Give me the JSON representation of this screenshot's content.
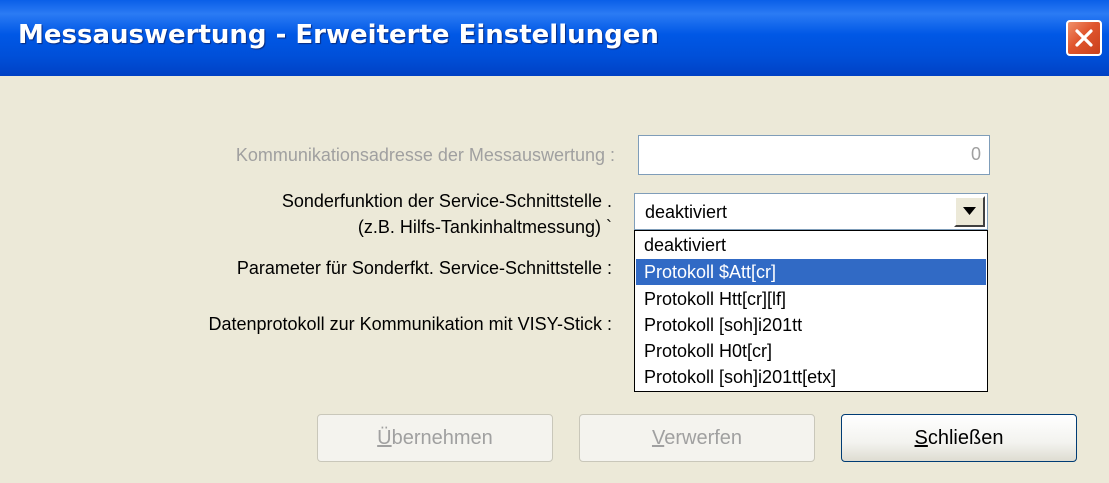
{
  "window": {
    "title": "Messauswertung - Erweiterte Einstellungen",
    "close_label": "×"
  },
  "form": {
    "address_label": "Kommunikationsadresse der Messauswertung :",
    "address_value": "0",
    "special_function_label_line1": "Sonderfunktion der Service-Schnittstelle .",
    "special_function_label_line2": "(z.B. Hilfs-Tankinhaltmessung) `",
    "special_function_value": "deaktiviert",
    "parameter_label": "Parameter für Sonderfkt. Service-Schnittstelle :",
    "protocol_label": "Datenprotokoll zur Kommunikation mit VISY-Stick :"
  },
  "dropdown": {
    "options": [
      "deaktiviert",
      "Protokoll $Att[cr]",
      "Protokoll Htt[cr][lf]",
      "Protokoll [soh]i201tt",
      "Protokoll H0t[cr]",
      "Protokoll [soh]i201tt[etx]"
    ],
    "highlighted_index": 1
  },
  "buttons": {
    "apply_mnemonic": "Ü",
    "apply_rest": "bernehmen",
    "discard_mnemonic": "V",
    "discard_rest": "erwerfen",
    "close_mnemonic": "S",
    "close_rest": "chließen"
  },
  "colors": {
    "titlebar": "#0058e6",
    "selection": "#316ac5",
    "dialog_bg": "#ece9d8",
    "close_button": "#e0552d"
  }
}
